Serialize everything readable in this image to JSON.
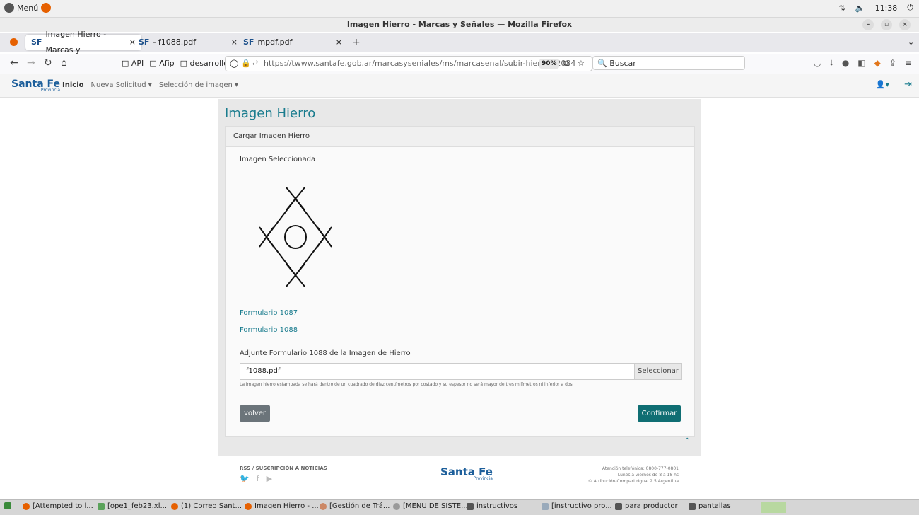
{
  "os": {
    "menu_label": "Menú",
    "clock": "11:38"
  },
  "window": {
    "title": "Imagen Hierro - Marcas y Señales — Mozilla Firefox"
  },
  "tabs": [
    {
      "prefix": "SF",
      "label": "Imagen Hierro - Marcas y",
      "close": "×"
    },
    {
      "prefix": "SF",
      "label": "- f1088.pdf",
      "close": "×"
    },
    {
      "prefix": "SF",
      "label": "mpdf.pdf",
      "close": "×"
    }
  ],
  "new_tab": "+",
  "bookmarks": [
    "API",
    "Afip",
    "desarrollo"
  ],
  "url": {
    "text": "https://twww.santafe.gob.ar/marcasyseniales/ms/marcasenal/subir-hierro/32034",
    "zoom": "90%"
  },
  "search": {
    "placeholder": "Buscar"
  },
  "site": {
    "logo": "Santa Fe",
    "logo_sub": "Provincia",
    "nav": {
      "home": "Inicio",
      "new_request": "Nueva Solicitud",
      "image_selection": "Selección de imagen"
    }
  },
  "main": {
    "title": "Imagen Hierro",
    "card_header": "Cargar Imagen Hierro",
    "selected_label": "Imagen Seleccionada",
    "link_1087": "Formulario 1087",
    "link_1088": "Formulario 1088",
    "attach_label": "Adjunte Formulario 1088 de la Imagen de Hierro",
    "file_value": "f1088.pdf",
    "select_button": "Seleccionar",
    "hint": "La imagen hierro estampada se hará dentro de un cuadrado de diez centímetros por costado y su espesor no será mayor de tres milímetros ni inferior a dos.",
    "back_button": "volver",
    "confirm_button": "Confirmar"
  },
  "footer": {
    "rss": "RSS / SUSCRIPCIÓN A NOTICIAS",
    "logo": "Santa Fe",
    "logo_sub": "Provincia",
    "phone": "Atención telefónica: 0800-777-0801",
    "hours": "Lunes a viernes de 8 a 18 hs",
    "license": "© Atribución-CompartirIgual 2.5 Argentina"
  },
  "taskbar": [
    "[Attempted to l...",
    "[ope1_feb23.xl...",
    "(1) Correo Sant...",
    "Imagen Hierro - ...",
    "[Gestión de Trá...",
    "[MENU DE SISTE...",
    "instructivos",
    "[instructivo pro...",
    "para productor",
    "pantallas"
  ]
}
